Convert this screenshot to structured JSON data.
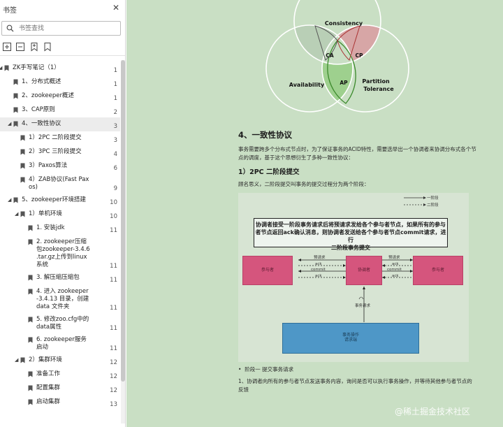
{
  "sidebar": {
    "title": "书签",
    "search_placeholder": "书签查找",
    "tools": [
      "expand-all-icon",
      "collapse-all-icon",
      "add-bookmark-icon",
      "bookmark-icon"
    ],
    "items": [
      {
        "label": "ZK手写笔记（1）",
        "page": "1",
        "level": 0,
        "arrow": "◢"
      },
      {
        "label": "1、分布式概述",
        "page": "1",
        "level": 1
      },
      {
        "label": "2、zookeeper概述",
        "page": "1",
        "level": 1
      },
      {
        "label": "3、CAP原则",
        "page": "2",
        "level": 1
      },
      {
        "label": "4、一致性协议",
        "page": "3",
        "level": 1,
        "arrow": "◢",
        "selected": true
      },
      {
        "label": "1）2PC 二阶段提交",
        "page": "3",
        "level": 2
      },
      {
        "label": "2）3PC 三阶段提交",
        "page": "4",
        "level": 2
      },
      {
        "label": "3）Paxos算法",
        "page": "6",
        "level": 2
      },
      {
        "label": "4）ZAB协议(Fast Paxos)",
        "label_lines": [
          "4）ZAB协议(Fast Pax",
          "os)"
        ],
        "page": "9",
        "level": 2
      },
      {
        "label": "5、zookeeper环境搭建",
        "page": "10",
        "level": 1,
        "arrow": "◢"
      },
      {
        "label": "1）单机环境",
        "page": "10",
        "level": 2,
        "arrow": "◢"
      },
      {
        "label": "1. 安装jdk",
        "page": "11",
        "level": 3
      },
      {
        "label": "2. zookeeper压缩包zookeeper-3.4.6.tar.gz上传到linux系统",
        "label_lines": [
          "2. zookeeper压缩",
          "包zookeeper-3.4.6",
          ".tar.gz上传到linux",
          "系统"
        ],
        "page": "11",
        "level": 3
      },
      {
        "label": "3. 解压缩压缩包",
        "page": "11",
        "level": 3
      },
      {
        "label": "4. 进入 zookeeper-3.4.13 目录，创建 data 文件夹",
        "label_lines": [
          "4. 进入 zookeeper",
          "-3.4.13 目录，创建",
          "data 文件夹"
        ],
        "page": "11",
        "level": 3
      },
      {
        "label": "5. 修改zoo.cfg中的data属性",
        "label_lines": [
          "5. 修改zoo.cfg中的",
          "data属性"
        ],
        "page": "11",
        "level": 3
      },
      {
        "label": "6. zookeeper服务启动",
        "label_lines": [
          "6. zookeeper服务",
          "启动"
        ],
        "page": "11",
        "level": 3
      },
      {
        "label": "2）集群环境",
        "page": "12",
        "level": 2,
        "arrow": "◢"
      },
      {
        "label": "准备工作",
        "page": "12",
        "level": 3
      },
      {
        "label": "配置集群",
        "page": "12",
        "level": 3
      },
      {
        "label": "启动集群",
        "page": "13",
        "level": 3
      }
    ]
  },
  "document": {
    "venn": {
      "top": "Consistency",
      "left": "Availability",
      "right_line1": "Partition",
      "right_line2": "Tolerance",
      "ca": "CA",
      "cp": "CP",
      "ap": "AP"
    },
    "section_title": "4、一致性协议",
    "intro_line1": "事务需要跨多个分布式节点时，为了保证事务的ACID特性，需要选举出一个协调者来协调分布式各个节",
    "intro_line2": "点的调度，基于这个思想衍生了多种一致性协议：",
    "subsection_title": "1）2PC 二阶段提交",
    "subsection_intro": "顾名思义，二阶段提交叫事务的提交过程分为两个阶段：",
    "figure": {
      "legend_1": "一阶段",
      "legend_2": "二阶段",
      "caption_line1": "协调者接受一阶段事务请求后将预请求发给各个参与者节点，如果所有的参与",
      "caption_line2": "者节点返回ack确认消息，则协调者发送给各个参与者节点commit请求，进行",
      "caption_line3": "二阶段事务提交",
      "participant_left": "参与者",
      "coordinator": "协调者",
      "participant_right": "参与者",
      "msg_prepare": "预请求",
      "msg_ack": "ack",
      "msg_commit": "commit",
      "request_label": "事务请求",
      "client_line1": "事务操作",
      "client_line2": "请求端"
    },
    "bullet_1": "阶段一 提交事务请求",
    "step_line1": "1、协调者向所有的参与者节点发送事务内容，询问是否可以执行事务操作，并等待其他参与者节点的",
    "step_line2": "反馈"
  },
  "watermark": "@稀土掘金技术社区"
}
